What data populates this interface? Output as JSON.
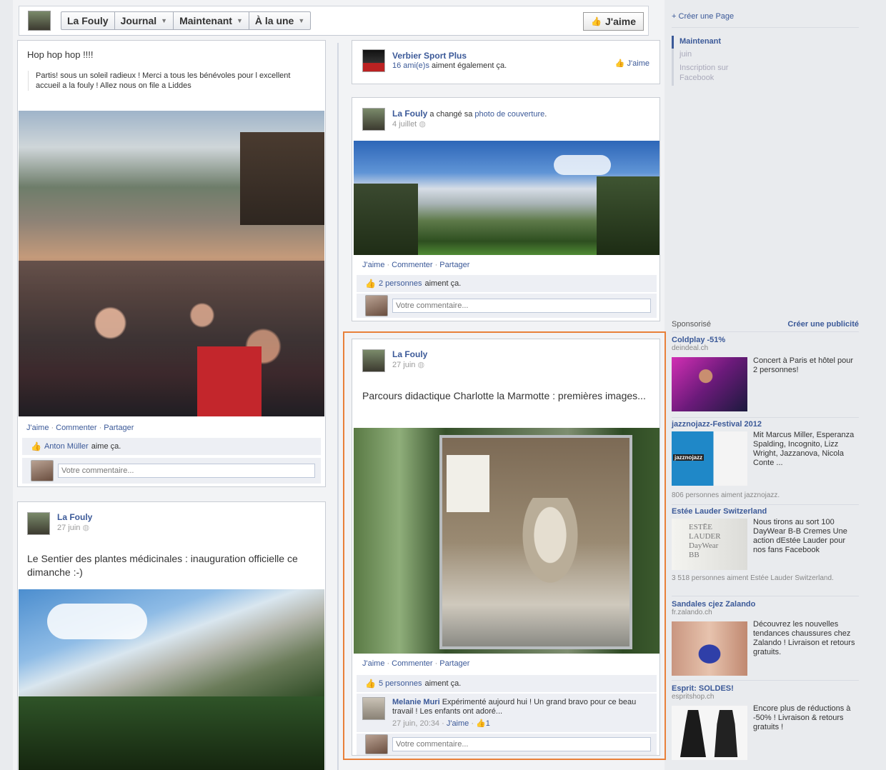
{
  "header": {
    "page_name": "La Fouly",
    "nav": [
      "Journal",
      "Maintenant",
      "À la une"
    ],
    "like_label": "J'aime"
  },
  "sidebar": {
    "create_page": "Créer une Page",
    "timeline_nav": [
      "Maintenant",
      "juin",
      "Inscription sur Facebook"
    ],
    "sponsored_label": "Sponsorisé",
    "create_ad": "Créer une publicité",
    "ads": [
      {
        "title": "Coldplay -51%",
        "domain": "deindeal.ch",
        "body": "Concert à Paris et hôtel pour 2 personnes!"
      },
      {
        "title": "jazznojazz-Festival 2012",
        "body": "Mit Marcus Miller, Esperanza Spalding, Incognito, Lizz Wright, Jazzanova, Nicola Conte ...",
        "social": "806 personnes aiment jazznojazz."
      },
      {
        "title": "Estée Lauder Switzerland",
        "body": "Nous tirons au sort 100 DayWear B-B Cremes Une action dEstée Lauder pour nos fans Facebook",
        "social": "3 518 personnes aiment Estée Lauder Switzerland."
      },
      {
        "title": "Sandales cjez Zalando",
        "domain": "fr.zalando.ch",
        "body": "Découvrez les nouvelles tendances chaussures chez Zalando ! Livraison et retours gratuits."
      },
      {
        "title": "Esprit: SOLDES!",
        "domain": "espritshop.ch",
        "body": "Encore plus de réductions à -50% ! Livraison & retours gratuits !"
      }
    ],
    "ad_image_text": {
      "jazz": "jazznojazz",
      "estee_1": "ESTĒE",
      "estee_2": "LAUDER",
      "estee_3": "DayWear",
      "estee_4": "BB"
    }
  },
  "posts": {
    "left1": {
      "title": "Hop hop hop !!!!",
      "text": "Partis! sous un soleil radieux ! Merci a tous les bénévoles pour l excellent accueil a la fouly ! Allez nous on file a Liddes",
      "actions": [
        "J'aime",
        "Commenter",
        "Partager"
      ],
      "likes_name": "Anton Müller",
      "likes_suffix": "aime ça.",
      "comment_placeholder": "Votre commentaire..."
    },
    "left2": {
      "author": "La Fouly",
      "date": "27 juin",
      "text": "Le Sentier des plantes médicinales : inauguration officielle ce dimanche :-)"
    },
    "right_like": {
      "name": "Verbier Sport Plus",
      "friends_link": "16 ami(e)s",
      "friends_suffix": "aiment également ça.",
      "like": "J'aime"
    },
    "right1": {
      "author": "La Fouly",
      "action": "a changé sa",
      "action_link": "photo de couverture",
      "date": "4 juillet",
      "actions": [
        "J'aime",
        "Commenter",
        "Partager"
      ],
      "likes_link": "2 personnes",
      "likes_suffix": "aiment ça.",
      "comment_placeholder": "Votre commentaire..."
    },
    "right2": {
      "author": "La Fouly",
      "date": "27 juin",
      "text": "Parcours didactique Charlotte la Marmotte : premières images...",
      "actions": [
        "J'aime",
        "Commenter",
        "Partager"
      ],
      "likes_link": "5 personnes",
      "likes_suffix": "aiment ça.",
      "comment_author": "Melanie Muri",
      "comment_text": "Expérimenté aujourd hui ! Un grand bravo pour ce beau travail ! Les enfants ont adoré...",
      "comment_time": "27 juin, 20:34",
      "comment_like": "J'aime",
      "comment_like_count": "1",
      "comment_placeholder": "Votre commentaire..."
    }
  },
  "colors": {
    "link": "#3b5998",
    "highlight": "#e8803a"
  }
}
